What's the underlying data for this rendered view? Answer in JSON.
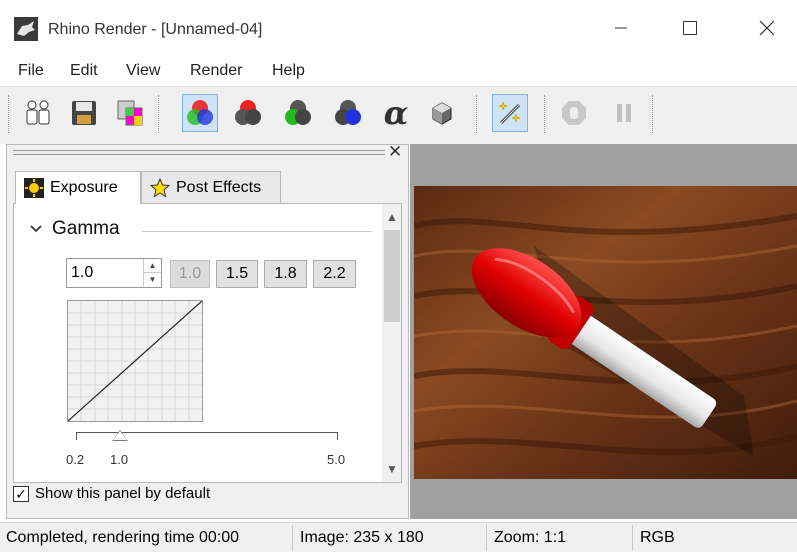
{
  "window": {
    "title": "Rhino Render - [Unnamed-04]",
    "controls": [
      "minimize-icon",
      "maximize-icon",
      "close-icon"
    ]
  },
  "menu": [
    "File",
    "Edit",
    "View",
    "Render",
    "Help"
  ],
  "toolbar": {
    "buttons": [
      "clone-icon",
      "save-icon",
      "copy-to-clipboard-icon",
      "rgb-channels-icon",
      "red-channel-icon",
      "green-channel-icon",
      "blue-channel-icon",
      "alpha-channel-icon",
      "material-sphere-icon",
      "post-effects-wand-icon",
      "stop-render-icon",
      "pause-render-icon"
    ],
    "alpha_glyph": "α"
  },
  "panel": {
    "tabs": [
      {
        "label": "Exposure",
        "active": true
      },
      {
        "label": "Post Effects",
        "active": false
      }
    ],
    "section": "Gamma",
    "gamma_value": "1.0",
    "presets": [
      {
        "label": "1.0",
        "disabled": true
      },
      {
        "label": "1.5",
        "disabled": false
      },
      {
        "label": "1.8",
        "disabled": false
      },
      {
        "label": "2.2",
        "disabled": false
      }
    ],
    "slider": {
      "min_label": "0.2",
      "current_label": "1.0",
      "max_label": "5.0",
      "value": 1.0,
      "min": 0.2,
      "max": 5.0
    },
    "show_by_default_label": "Show this panel by default",
    "show_by_default_checked": true
  },
  "status": {
    "message": "Completed, rendering time 00:00",
    "image_size": "Image: 235 x 180",
    "zoom": "Zoom: 1:1",
    "channel": "RGB"
  },
  "colors": {
    "toolbar_bg": "#f0f0f0",
    "pressed": "#cfe3f7",
    "render_bg": "#a0a0a0",
    "handle_red": "#e01010"
  }
}
